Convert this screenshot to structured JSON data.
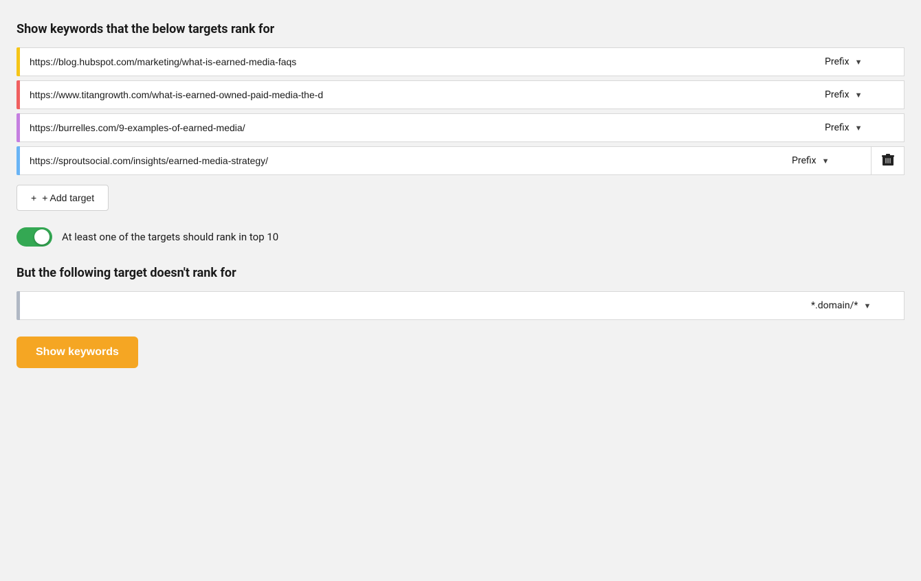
{
  "page": {
    "section1_title": "Show keywords that the below targets rank for",
    "targets": [
      {
        "id": "target-1",
        "color": "#f5c518",
        "url": "https://blog.hubspot.com/marketing/what-is-earned-media-faqs",
        "prefix_label": "Prefix",
        "show_delete": false
      },
      {
        "id": "target-2",
        "color": "#f06060",
        "url": "https://www.titangrowth.com/what-is-earned-owned-paid-media-the-d",
        "prefix_label": "Prefix",
        "show_delete": false
      },
      {
        "id": "target-3",
        "color": "#c580e0",
        "url": "https://burrelles.com/9-examples-of-earned-media/",
        "prefix_label": "Prefix",
        "show_delete": false
      },
      {
        "id": "target-4",
        "color": "#6ab4f5",
        "url": "https://sproutsocial.com/insights/earned-media-strategy/",
        "prefix_label": "Prefix",
        "show_delete": true
      }
    ],
    "add_target_label": "+ Add target",
    "toggle_label": "At least one of the targets should rank in top 10",
    "toggle_checked": true,
    "section2_title": "But the following target doesn't rank for",
    "exclusion_url": "",
    "exclusion_url_placeholder": "",
    "exclusion_match_label": "*.domain/*",
    "show_keywords_label": "Show keywords"
  }
}
